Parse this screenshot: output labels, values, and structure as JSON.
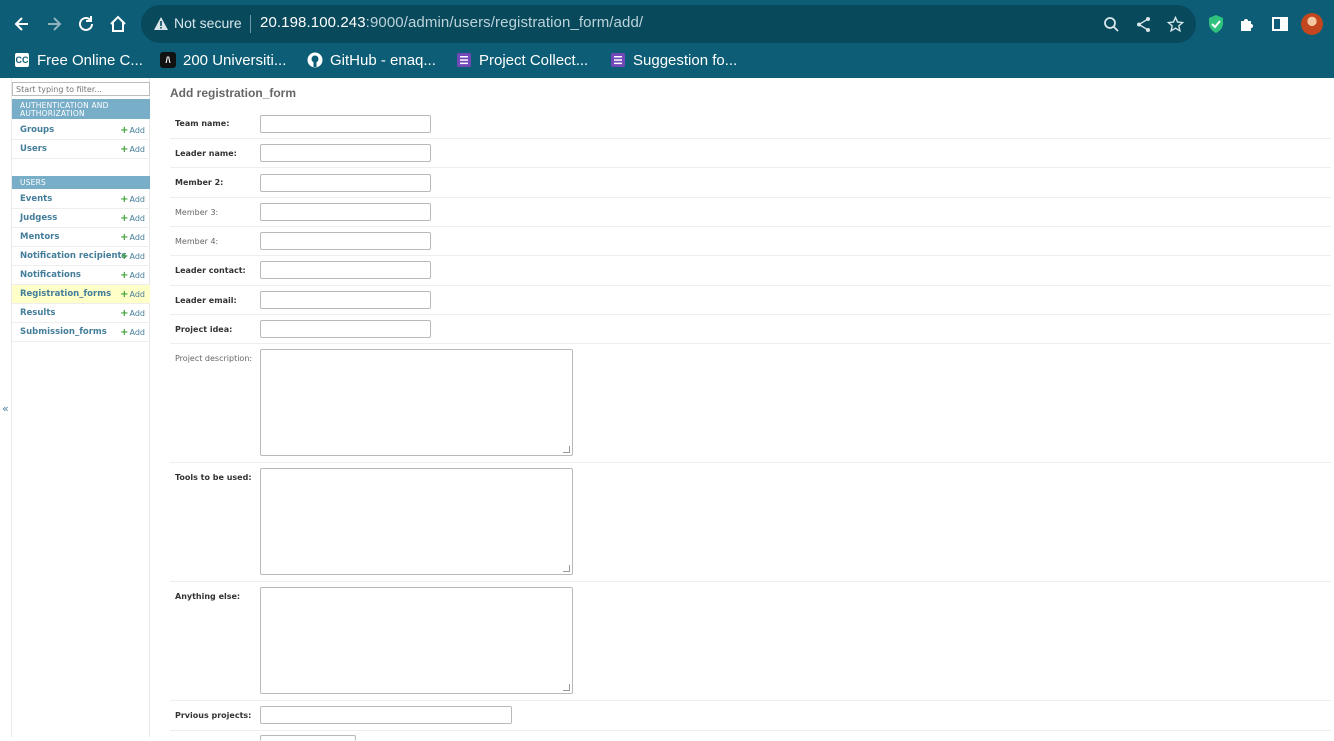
{
  "browser": {
    "security_label": "Not secure",
    "url_host": "20.198.100.243",
    "url_rest": ":9000/admin/users/registration_form/add/"
  },
  "bookmarks": [
    {
      "label": "Free Online C...",
      "icon": "cc-favicon"
    },
    {
      "label": "200 Universiti...",
      "icon": "a-favicon"
    },
    {
      "label": "GitHub - enaq...",
      "icon": "github-icon"
    },
    {
      "label": "Project Collect...",
      "icon": "form-favicon"
    },
    {
      "label": "Suggestion fo...",
      "icon": "form-favicon"
    }
  ],
  "sidebar": {
    "filter_placeholder": "Start typing to filter...",
    "modules": [
      {
        "title": "AUTHENTICATION AND AUTHORIZATION",
        "models": [
          {
            "name": "Groups",
            "add": "Add"
          },
          {
            "name": "Users",
            "add": "Add"
          }
        ]
      },
      {
        "title": "USERS",
        "models": [
          {
            "name": "Events",
            "add": "Add"
          },
          {
            "name": "Judgess",
            "add": "Add"
          },
          {
            "name": "Mentors",
            "add": "Add"
          },
          {
            "name": "Notification recipients",
            "add": "Add"
          },
          {
            "name": "Notifications",
            "add": "Add"
          },
          {
            "name": "Registration_forms",
            "add": "Add",
            "active": true
          },
          {
            "name": "Results",
            "add": "Add"
          },
          {
            "name": "Submission_forms",
            "add": "Add"
          }
        ]
      }
    ],
    "collapse_glyph": "«"
  },
  "form": {
    "title": "Add registration_form",
    "fields": [
      {
        "label": "Team name:",
        "required": true,
        "type": "text",
        "value": ""
      },
      {
        "label": "Leader name:",
        "required": true,
        "type": "text",
        "value": ""
      },
      {
        "label": "Member 2:",
        "required": true,
        "type": "text",
        "value": ""
      },
      {
        "label": "Member 3:",
        "required": false,
        "type": "text",
        "value": ""
      },
      {
        "label": "Member 4:",
        "required": false,
        "type": "text",
        "value": ""
      },
      {
        "label": "Leader contact:",
        "required": true,
        "type": "text",
        "value": ""
      },
      {
        "label": "Leader email:",
        "required": true,
        "type": "text",
        "value": ""
      },
      {
        "label": "Project idea:",
        "required": true,
        "type": "text",
        "value": ""
      },
      {
        "label": "Project description:",
        "required": false,
        "type": "textarea",
        "value": ""
      },
      {
        "label": "Tools to be used:",
        "required": true,
        "type": "textarea",
        "value": ""
      },
      {
        "label": "Anything else:",
        "required": true,
        "type": "textarea",
        "value": ""
      },
      {
        "label": "Prvious projects:",
        "required": true,
        "type": "text-wide",
        "value": ""
      }
    ]
  },
  "colors": {
    "chrome": "#0c5d75",
    "module_header": "#79aec8",
    "link": "#447e9b",
    "add_plus": "#40a33c",
    "active_row": "#ffffc8"
  }
}
